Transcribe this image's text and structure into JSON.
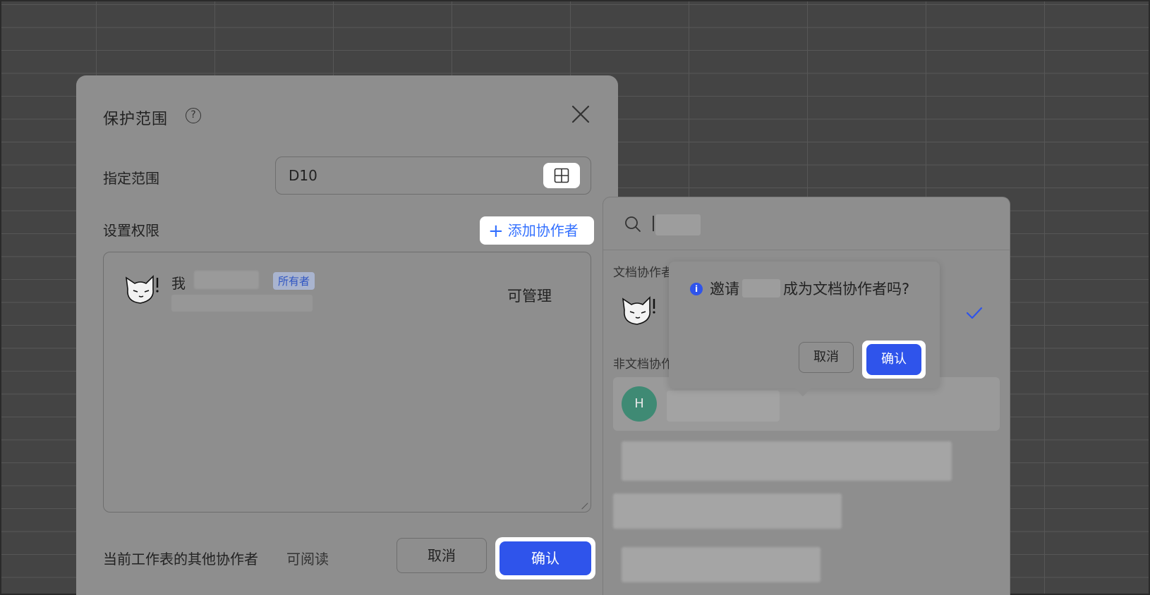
{
  "dialog": {
    "title": "保护范围",
    "range_label": "指定范围",
    "range_value": "D10",
    "permissions_label": "设置权限",
    "add_collaborator_label": "添加协作者",
    "collaborators": [
      {
        "me_label": "我",
        "badge": "所有者",
        "permission": "可管理"
      }
    ],
    "other_collaborators_label": "当前工作表的其他协作者",
    "other_collaborators_value": "可阅读",
    "cancel_label": "取消",
    "confirm_label": "确认"
  },
  "search_panel": {
    "doc_collaborators_section": "文档协作者",
    "non_doc_collaborators_section": "非文档协作者",
    "result_avatar_letter": "H"
  },
  "popover": {
    "message_prefix": "邀请",
    "message_suffix": "成为文档协作者吗?",
    "cancel_label": "取消",
    "confirm_label": "确认"
  },
  "colors": {
    "accent": "#2f54eb",
    "link": "#3370ff",
    "avatar_h": "#3f8a74"
  },
  "icons": [
    "help-icon",
    "close-icon",
    "grid-icon",
    "plus-icon",
    "search-icon",
    "check-icon",
    "info-icon"
  ]
}
